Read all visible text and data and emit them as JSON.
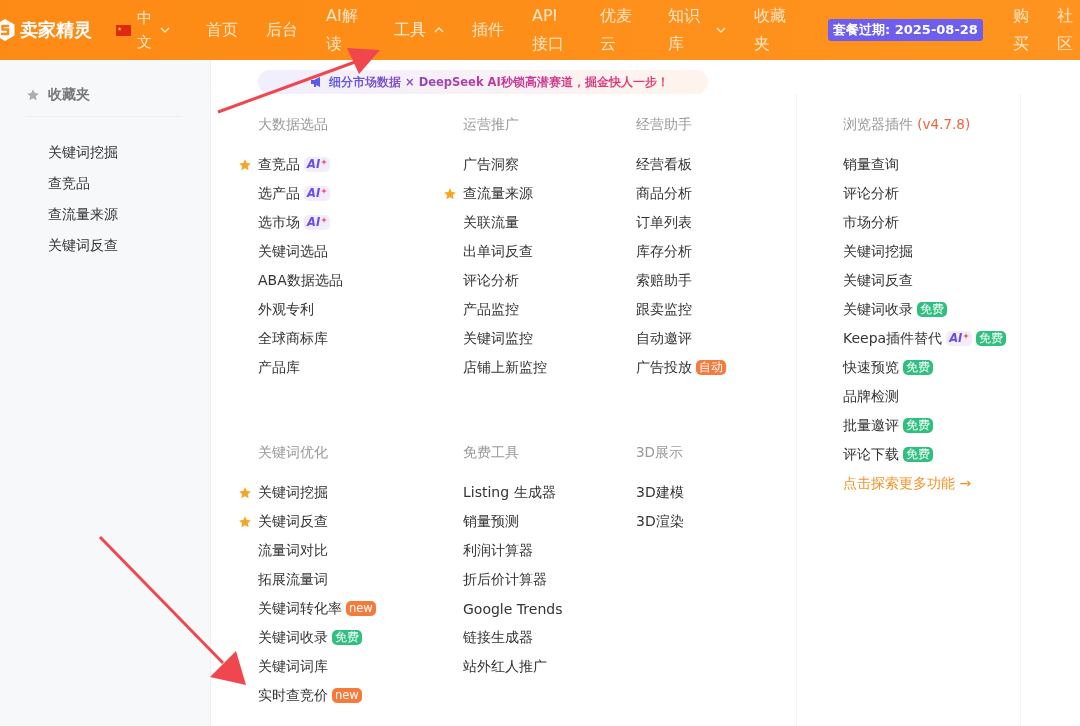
{
  "header": {
    "logo": "卖家精灵",
    "language": {
      "label": "中文",
      "expanded": false
    },
    "nav": [
      {
        "label": "首页",
        "kind": "link",
        "expanded": false
      },
      {
        "label": "后台",
        "kind": "link",
        "expanded": false
      },
      {
        "label": "AI解读",
        "kind": "link",
        "expanded": false
      },
      {
        "label": "工具",
        "kind": "menu",
        "expanded": true
      },
      {
        "label": "插件",
        "kind": "link",
        "expanded": false
      },
      {
        "label": "API接口",
        "kind": "link",
        "expanded": false
      },
      {
        "label": "优麦云",
        "kind": "link",
        "expanded": false
      },
      {
        "label": "知识库",
        "kind": "menu",
        "expanded": false
      },
      {
        "label": "收藏夹",
        "kind": "link",
        "expanded": false
      }
    ],
    "expiry": "套餐过期: 2025-08-28",
    "links": [
      "购买",
      "社区"
    ]
  },
  "sidebar": {
    "title": "收藏夹",
    "items": [
      "关键词挖掘",
      "查竞品",
      "查流量来源",
      "关键词反查"
    ]
  },
  "banner": "细分市场数据 × DeepSeek AI秒锁高潜赛道，掘金快人一步！",
  "groups": [
    {
      "title": "大数据选品",
      "items": [
        {
          "label": "查竞品",
          "starred": true,
          "badges": [
            {
              "kind": "ai",
              "text": "AI"
            }
          ]
        },
        {
          "label": "选产品",
          "starred": false,
          "badges": [
            {
              "kind": "ai",
              "text": "AI"
            }
          ]
        },
        {
          "label": "选市场",
          "starred": false,
          "badges": [
            {
              "kind": "ai",
              "text": "AI"
            }
          ]
        },
        {
          "label": "关键词选品",
          "starred": false
        },
        {
          "label": "ABA数据选品",
          "starred": false
        },
        {
          "label": "外观专利",
          "starred": false
        },
        {
          "label": "全球商标库",
          "starred": false
        },
        {
          "label": "产品库",
          "starred": false
        }
      ]
    },
    {
      "title": "运营推广",
      "items": [
        {
          "label": "广告洞察",
          "starred": false
        },
        {
          "label": "查流量来源",
          "starred": true
        },
        {
          "label": "关联流量",
          "starred": false
        },
        {
          "label": "出单词反查",
          "starred": false
        },
        {
          "label": "评论分析",
          "starred": false
        },
        {
          "label": "产品监控",
          "starred": false
        },
        {
          "label": "关键词监控",
          "starred": false
        },
        {
          "label": "店铺上新监控",
          "starred": false
        }
      ]
    },
    {
      "title": "经营助手",
      "items": [
        {
          "label": "经营看板",
          "starred": false
        },
        {
          "label": "商品分析",
          "starred": false
        },
        {
          "label": "订单列表",
          "starred": false
        },
        {
          "label": "库存分析",
          "starred": false
        },
        {
          "label": "索赔助手",
          "starred": false
        },
        {
          "label": "跟卖监控",
          "starred": false
        },
        {
          "label": "自动邀评",
          "starred": false
        },
        {
          "label": "广告投放",
          "starred": false,
          "badges": [
            {
              "kind": "auto",
              "text": "自动"
            }
          ]
        }
      ]
    },
    {
      "title": "关键词优化",
      "items": [
        {
          "label": "关键词挖掘",
          "starred": true
        },
        {
          "label": "关键词反查",
          "starred": true
        },
        {
          "label": "流量词对比",
          "starred": false
        },
        {
          "label": "拓展流量词",
          "starred": false
        },
        {
          "label": "关键词转化率",
          "starred": false,
          "badges": [
            {
              "kind": "new",
              "text": "new"
            }
          ]
        },
        {
          "label": "关键词收录",
          "starred": false,
          "badges": [
            {
              "kind": "free",
              "text": "免费"
            }
          ]
        },
        {
          "label": "关键词词库",
          "starred": false
        },
        {
          "label": "实时查竞价",
          "starred": false,
          "badges": [
            {
              "kind": "new",
              "text": "new"
            }
          ]
        }
      ]
    },
    {
      "title": "免费工具",
      "items": [
        {
          "label": "Listing 生成器",
          "starred": false
        },
        {
          "label": "销量预测",
          "starred": false
        },
        {
          "label": "利润计算器",
          "starred": false
        },
        {
          "label": "折后价计算器",
          "starred": false
        },
        {
          "label": "Google Trends",
          "starred": false
        },
        {
          "label": "链接生成器",
          "starred": false
        },
        {
          "label": "站外红人推广",
          "starred": false
        }
      ]
    },
    {
      "title": "3D展示",
      "items": [
        {
          "label": "3D建模",
          "starred": false
        },
        {
          "label": "3D渲染",
          "starred": false
        }
      ]
    }
  ],
  "plugin": {
    "title": "浏览器插件",
    "version": "(v4.7.8)",
    "items": [
      {
        "label": "销量查询"
      },
      {
        "label": "评论分析"
      },
      {
        "label": "市场分析"
      },
      {
        "label": "关键词挖掘"
      },
      {
        "label": "关键词反查"
      },
      {
        "label": "关键词收录",
        "badges": [
          {
            "kind": "free",
            "text": "免费"
          }
        ]
      },
      {
        "label": "Keepa插件替代",
        "badges": [
          {
            "kind": "ai",
            "text": "AI"
          },
          {
            "kind": "free",
            "text": "免费"
          }
        ]
      },
      {
        "label": "快速预览",
        "badges": [
          {
            "kind": "free",
            "text": "免费"
          }
        ]
      },
      {
        "label": "品牌检测"
      },
      {
        "label": "批量邀评",
        "badges": [
          {
            "kind": "free",
            "text": "免费"
          }
        ]
      },
      {
        "label": "评论下载",
        "badges": [
          {
            "kind": "free",
            "text": "免费"
          }
        ]
      }
    ],
    "more": "点击探索更多功能 →"
  }
}
